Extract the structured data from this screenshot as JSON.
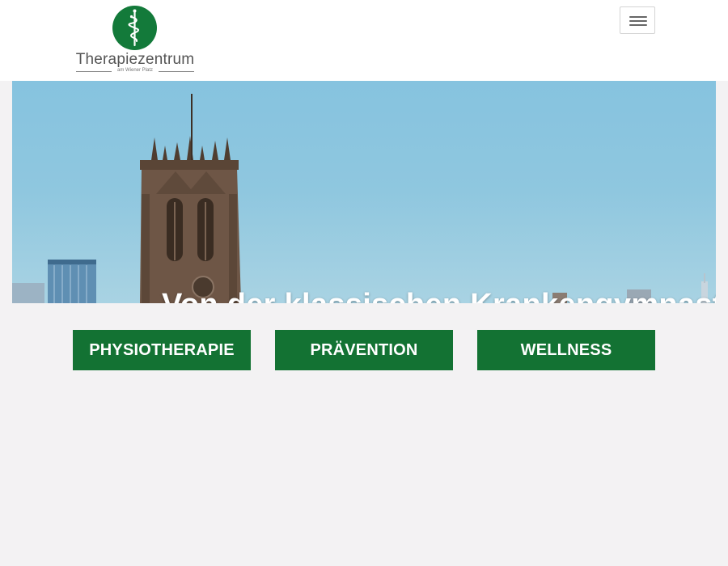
{
  "brand": {
    "name": "Therapiezentrum",
    "subtitle": "am Wiener Platz",
    "logo_icon": "rod-of-asclepius-icon",
    "logo_color": "#137a3a"
  },
  "nav": {
    "toggle_icon": "hamburger-menu-icon"
  },
  "hero": {
    "caption": "Von der klassischen Krankengymnastik"
  },
  "categories": [
    {
      "label": "PHYSIOTHERAPIE"
    },
    {
      "label": "PRÄVENTION"
    },
    {
      "label": "WELLNESS"
    }
  ],
  "colors": {
    "button_green": "#137233",
    "page_background": "#f3f2f3",
    "sky_blue": "#86c3df"
  }
}
